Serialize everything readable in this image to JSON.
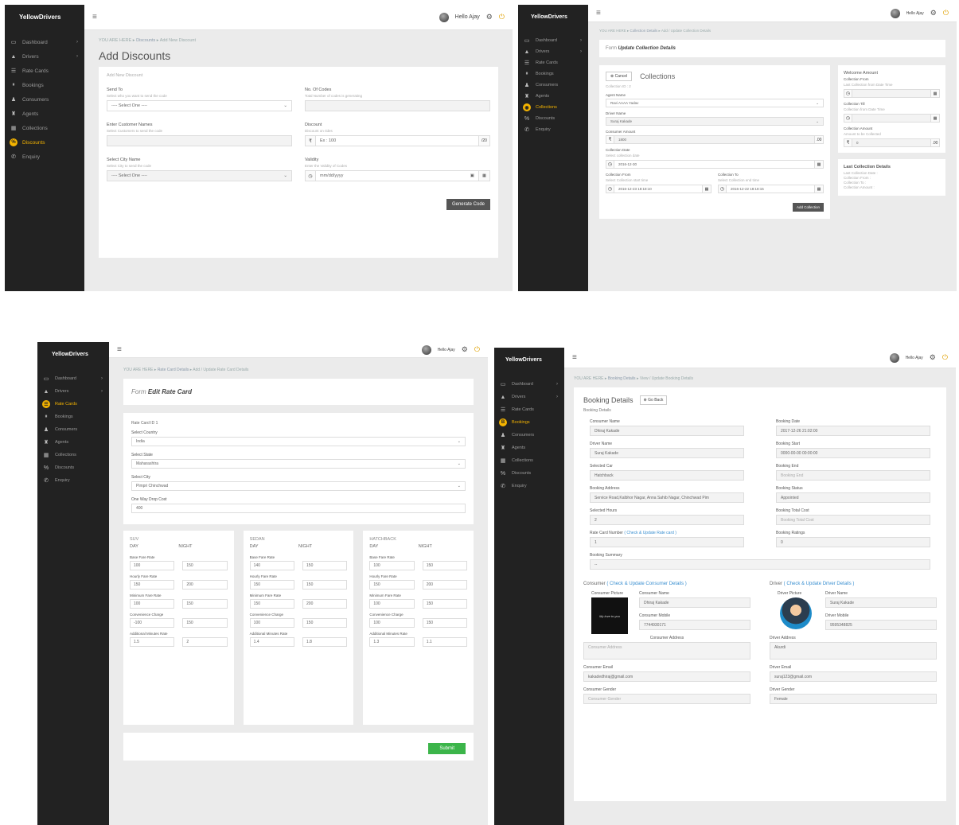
{
  "common": {
    "brand": "YellowDrivers",
    "menu_icon": "hamburger-icon",
    "user_greeting": "Hello Ajay",
    "crumb_here": "YOU ARE HERE",
    "nav": [
      "Dashboard",
      "Drivers",
      "Rate Cards",
      "Bookings",
      "Consumers",
      "Agents",
      "Collections",
      "Discounts",
      "Enquiry"
    ]
  },
  "discounts": {
    "crumb_section": "Discounts",
    "crumb_page": "Add New Discount",
    "title": "Add Discounts",
    "card_title": "Add New Discount",
    "send_to_label": "Send To",
    "send_to_hint": "Select who you want to send the code",
    "send_to_value": "---- Select One ----",
    "codes_label": "No. Of Codes",
    "codes_hint": "Total Number of codes is generating",
    "customer_label": "Enter Customer Names",
    "customer_hint": "Select Customers to send the code",
    "discount_label": "Discount",
    "discount_hint": "Discount on rides",
    "discount_prefix": "₹",
    "discount_placeholder": "Ex : 100",
    "discount_suffix": "/20",
    "city_label": "Select City Name",
    "city_hint": "Select City to send the code",
    "city_value": "---- Select One ----",
    "validity_label": "Validity",
    "validity_hint": "Enter the Validity of Codes",
    "validity_value": "mm/dd/yyyy",
    "generate_label": "Generate Code"
  },
  "collections": {
    "crumb_section": "Collection Details",
    "crumb_page": "Add / Update Collection Details",
    "form_prefix": "Form",
    "form_title": "Update Collection Details",
    "cancel_label": "Cancel",
    "heading": "Collections",
    "collection_id": "Collection ID : 2",
    "agent_label": "Agent Name",
    "agent_value": "Ravi AAAA Yadav",
    "driver_label": "Driver Name",
    "driver_value": "Suraj Kakade",
    "amount_label": "Consumer Amount",
    "amount_value": "1800",
    "date_label": "Collection Date",
    "date_hint": "Select collection date",
    "date_value": "2016-12-30",
    "from_label": "Collection From",
    "from_hint": "Select Collection start time",
    "from_value": "2016-12-23 18:18:10",
    "to_label": "Collection To",
    "to_hint": "Select Collection end time",
    "to_value": "2016-12-22 18:18:15",
    "add_label": "Add Collection",
    "right_title": "Welcome Amount",
    "from_r_label": "Collection From",
    "from_r_hint": "Last Collection from Date Time",
    "till_label": "Collection Till",
    "till_hint": "Collection from Date Time",
    "camount_label": "Collection Amount",
    "camount_hint": "Amount to be Collected",
    "camount_value": "0",
    "camount_suffix": ".00",
    "last_title": "Last Collection Details",
    "last_items": [
      "Last Collection Date :",
      "Collection From :",
      "Collection To :",
      "Collection Amount :"
    ]
  },
  "ratecard": {
    "crumb_section": "Rate Card Details",
    "crumb_page": "Add / Update Rate Card Details",
    "form_prefix": "Form",
    "form_title": "Edit Rate Card",
    "rc_id": "Rate Card ID 1",
    "country_label": "Select Country",
    "country_value": "India",
    "state_label": "Select State",
    "state_value": "Maharashtra",
    "city_label": "Select City",
    "city_value": "Pimpri Chinchwad",
    "oneway_label": "One Way Drop Cost",
    "oneway_value": "400",
    "day_label": "DAY",
    "night_label": "NIGHT",
    "f_base": "Base Fare Rate",
    "f_hourly": "Hourly Fare Rate",
    "f_min": "Minimum Fare Rate",
    "f_conv": "Convenience Charge",
    "f_add": "Additional Minutes Rate",
    "vehicles": [
      {
        "name": "SUV",
        "base": [
          "100",
          "150"
        ],
        "hourly": [
          "150",
          "200"
        ],
        "min": [
          "100",
          "150"
        ],
        "conv": [
          "-100",
          "150"
        ],
        "add": [
          "1.5",
          "2"
        ]
      },
      {
        "name": "SEDAN",
        "base": [
          "140",
          "150"
        ],
        "hourly": [
          "150",
          "150"
        ],
        "min": [
          "150",
          "200"
        ],
        "conv": [
          "100",
          "150"
        ],
        "add": [
          "1.4",
          "1.8"
        ]
      },
      {
        "name": "HATCHBACK",
        "base": [
          "100",
          "150"
        ],
        "hourly": [
          "150",
          "200"
        ],
        "min": [
          "100",
          "150"
        ],
        "conv": [
          "100",
          "150"
        ],
        "add": [
          "1.3",
          "1.1"
        ]
      }
    ],
    "submit_label": "Submit"
  },
  "booking": {
    "crumb_section": "Booking Details",
    "crumb_page": "View / Update Booking Details",
    "title": "Booking Details",
    "back_label": "Go Back",
    "sub": "Booking Details",
    "left": [
      {
        "label": "Consumer Name",
        "value": "Dhiraj Kakade"
      },
      {
        "label": "Driver Name",
        "value": "Suraj Kakade"
      },
      {
        "label": "Selected Car",
        "value": "Hatchback"
      },
      {
        "label": "Booking Address",
        "value": "Service Road,Kalbhor Nagar, Anna Sahib Nagar, Chinchwad Pim"
      },
      {
        "label": "Selected Hours",
        "value": "2"
      }
    ],
    "rc_label": "Rate Card Number",
    "rc_link": "( Check & Update Rate card )",
    "rc_value": "1",
    "right": [
      {
        "label": "Booking Date",
        "value": "2017-12-26 21:02:00"
      },
      {
        "label": "Booking Start",
        "value": "0000-00-00 00:00:00"
      },
      {
        "label": "Booking End",
        "value": "Booking End"
      },
      {
        "label": "Booking Status",
        "value": "Appointed"
      },
      {
        "label": "Booking Total Cost",
        "value": "Booking Total Cost"
      },
      {
        "label": "Booking Ratings",
        "value": "0"
      }
    ],
    "summary_label": "Booking Summary",
    "summary_value": "--",
    "consumer_head": "Consumer",
    "consumer_link": "( Check & Update Consumer Details )",
    "driver_head": "Driver",
    "driver_link": "( Check & Update Driver Details )",
    "c_pic_label": "Consumer Picture",
    "c_pic_text": "My love to you",
    "c_name_label": "Consumer Name",
    "c_name_value": "Dhiraj Kakade",
    "c_mobile_label": "Consumer Mobile",
    "c_mobile_value": "7744930171",
    "c_addr_label": "Consumer Address",
    "c_addr_value": "Consumer Address",
    "c_email_label": "Consumer Email",
    "c_email_value": "kakadedhiraj@gmail.com",
    "c_gender_label": "Consumer Gender",
    "c_gender_value": "Consumer Gender",
    "d_pic_label": "Driver Picture",
    "d_name_label": "Driver Name",
    "d_name_value": "Suraj Kakade",
    "d_mobile_label": "Driver Mobile",
    "d_mobile_value": "9595348825",
    "d_addr_label": "Driver Address",
    "d_addr_value": "Akurdi",
    "d_email_label": "Driver Email",
    "d_email_value": "suraj123@gmail.com",
    "d_gender_label": "Driver Gender",
    "d_gender_value": "Female"
  }
}
